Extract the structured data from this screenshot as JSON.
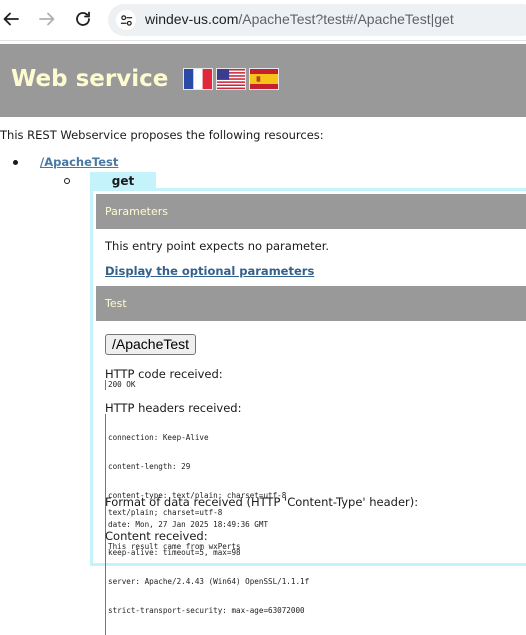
{
  "browser": {
    "url_host": "windev-us.com",
    "url_path": "/ApacheTest?test#/ApacheTest|get"
  },
  "header": {
    "title": "Web service",
    "languages": [
      "French",
      "English (US)",
      "Spanish"
    ]
  },
  "content": {
    "intro": "This REST Webservice proposes the following resources:",
    "resource": "/ApacheTest",
    "method": "get",
    "parameters": {
      "heading": "Parameters",
      "text": "This entry point expects no parameter.",
      "optional_link": "Display the optional parameters"
    },
    "test": {
      "heading": "Test",
      "button": "/ApacheTest",
      "http_code_label": "HTTP code received:",
      "http_code": "200 OK",
      "headers_label": "HTTP headers received:",
      "headers": [
        "connection: Keep-Alive",
        "content-length: 29",
        "content-type: text/plain; charset=utf-8",
        "date: Mon, 27 Jan 2025 18:49:36 GMT",
        "keep-alive: timeout=5, max=98",
        "server: Apache/2.4.43 (Win64) OpenSSL/1.1.1f",
        "strict-transport-security: max-age=63072000"
      ],
      "format_label": "Format of data received (HTTP 'Content-Type' header):",
      "format": "text/plain; charset=utf-8",
      "content_label": "Content received:",
      "content": "This result came from wxPerts"
    }
  },
  "colors": {
    "header_bg": "#999999",
    "header_text": "#fffbd0",
    "panel_border": "#c5f3fb",
    "link": "#4a78a4"
  }
}
